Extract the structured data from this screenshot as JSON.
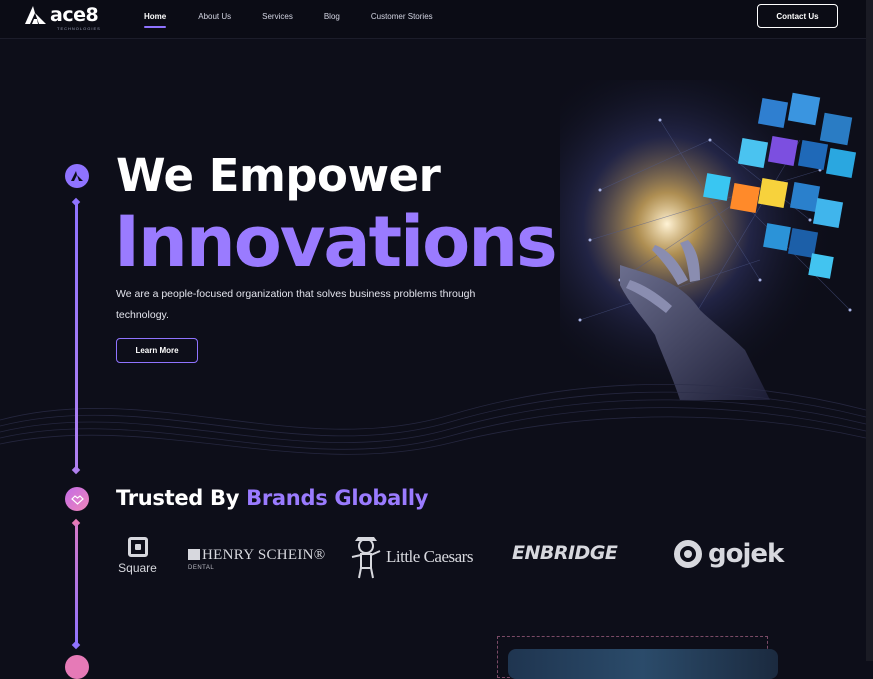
{
  "nav": {
    "logo_text": "ace8",
    "logo_tagline": "TECHNOLOGIES",
    "links": [
      {
        "label": "Home",
        "active": true
      },
      {
        "label": "About Us",
        "active": false
      },
      {
        "label": "Services",
        "active": false
      },
      {
        "label": "Blog",
        "active": false
      },
      {
        "label": "Customer Stories",
        "active": false
      }
    ],
    "contact_label": "Contact Us"
  },
  "hero": {
    "title_line1": "We Empower",
    "title_line2": "Innovations",
    "description": "We are a people-focused organization that solves business problems through technology.",
    "cta_label": "Learn More"
  },
  "trusted": {
    "title_plain": "Trusted By",
    "title_accent": "Brands Globally",
    "brands": [
      {
        "name": "Square"
      },
      {
        "name": "HENRY SCHEIN®",
        "sub": "DENTAL"
      },
      {
        "name": "Little Caesars"
      },
      {
        "name": "ENBRIDGE"
      },
      {
        "name": "gojek"
      }
    ]
  },
  "colors": {
    "background": "#0d0e19",
    "accent_purple": "#9a7bff",
    "accent_pink": "#e67ab7"
  },
  "icons": [
    "ace8-logo-icon",
    "brand-mark-icon",
    "handshake-icon",
    "square-logo-icon",
    "henry-schein-icon",
    "little-caesars-icon",
    "gojek-icon"
  ]
}
